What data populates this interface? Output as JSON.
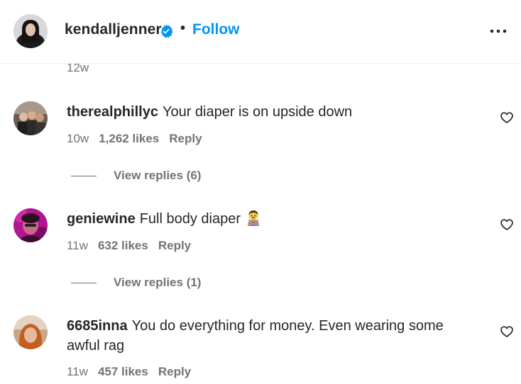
{
  "header": {
    "username": "kendalljenner",
    "separator": "•",
    "follow_label": "Follow",
    "verified_icon": "verified-badge-icon",
    "more_icon": "more-options-icon"
  },
  "previous": {
    "time": "12w"
  },
  "comments": [
    {
      "username": "therealphillyc",
      "text": "Your diaper is on upside down",
      "time": "10w",
      "likes": "1,262 likes",
      "reply_label": "Reply",
      "view_replies": "View replies (6)"
    },
    {
      "username": "geniewine",
      "text": "Full body diaper",
      "emoji": "person-gesturing-no-emoji",
      "time": "11w",
      "likes": "632 likes",
      "reply_label": "Reply",
      "view_replies": "View replies (1)"
    },
    {
      "username": "6685inna",
      "text": "You do everything for money. Even wearing some awful rag",
      "time": "11w",
      "likes": "457 likes",
      "reply_label": "Reply"
    }
  ],
  "colors": {
    "text": "#262626",
    "secondary": "#737373",
    "link": "#0095f6",
    "divider": "#efefef"
  }
}
